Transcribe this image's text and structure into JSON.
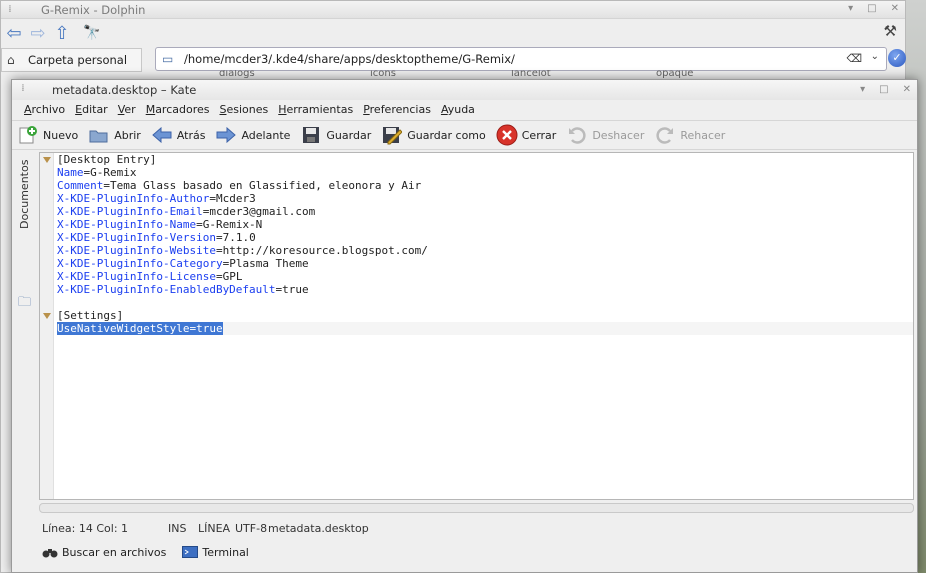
{
  "dolphin": {
    "title": "G-Remix - Dolphin",
    "places_label": "Carpeta personal",
    "location_path": "/home/mcder3/.kde4/share/apps/desktoptheme/G-Remix/",
    "column_headers": [
      "dialogs",
      "icons",
      "lancelot",
      "opaque"
    ]
  },
  "kate": {
    "title": "metadata.desktop – Kate",
    "menu": [
      {
        "accel": "A",
        "rest": "rchivo"
      },
      {
        "accel": "E",
        "rest": "ditar"
      },
      {
        "accel": "V",
        "rest": "er"
      },
      {
        "accel": "M",
        "rest": "arcadores"
      },
      {
        "accel": "S",
        "rest": "esiones"
      },
      {
        "accel": "H",
        "rest": "erramientas"
      },
      {
        "accel": "P",
        "rest": "referencias"
      },
      {
        "accel": "A",
        "rest": "yuda"
      }
    ],
    "toolbar": {
      "new": "Nuevo",
      "open": "Abrir",
      "back": "Atrás",
      "forward": "Adelante",
      "save": "Guardar",
      "save_as": "Guardar como",
      "close": "Cerrar",
      "undo": "Deshacer",
      "redo": "Rehacer"
    },
    "side_tab": "Documentos",
    "code_lines": [
      {
        "key": "",
        "value": "[Desktop Entry]"
      },
      {
        "key": "Name",
        "value": "G-Remix"
      },
      {
        "key": "Comment",
        "value": "Tema Glass basado en Glassified, eleonora y Air"
      },
      {
        "key": "X-KDE-PluginInfo-Author",
        "value": "Mcder3"
      },
      {
        "key": "X-KDE-PluginInfo-Email",
        "value": "mcder3@gmail.com"
      },
      {
        "key": "X-KDE-PluginInfo-Name",
        "value": "G-Remix-N"
      },
      {
        "key": "X-KDE-PluginInfo-Version",
        "value": "7.1.0"
      },
      {
        "key": "X-KDE-PluginInfo-Website",
        "value": "http://koresource.blogspot.com/"
      },
      {
        "key": "X-KDE-PluginInfo-Category",
        "value": "Plasma Theme"
      },
      {
        "key": "X-KDE-PluginInfo-License",
        "value": "GPL"
      },
      {
        "key": "X-KDE-PluginInfo-EnabledByDefault",
        "value": "true"
      },
      {
        "key": "",
        "value": ""
      },
      {
        "key": "",
        "value": "[Settings]"
      },
      {
        "key": "UseNativeWidgetStyle",
        "value": "true",
        "selected": true
      }
    ],
    "status": {
      "position": "Línea: 14 Col: 1",
      "mode": "INS",
      "line_mode": "LÍNEA",
      "encoding": "UTF-8",
      "filename": "metadata.desktop"
    },
    "bottom": {
      "search_files": "Buscar en archivos",
      "terminal": "Terminal"
    }
  },
  "colors": {
    "key": "#1b3ef0",
    "selection": "#3f77d4",
    "fold_marker": "#b9914a"
  }
}
